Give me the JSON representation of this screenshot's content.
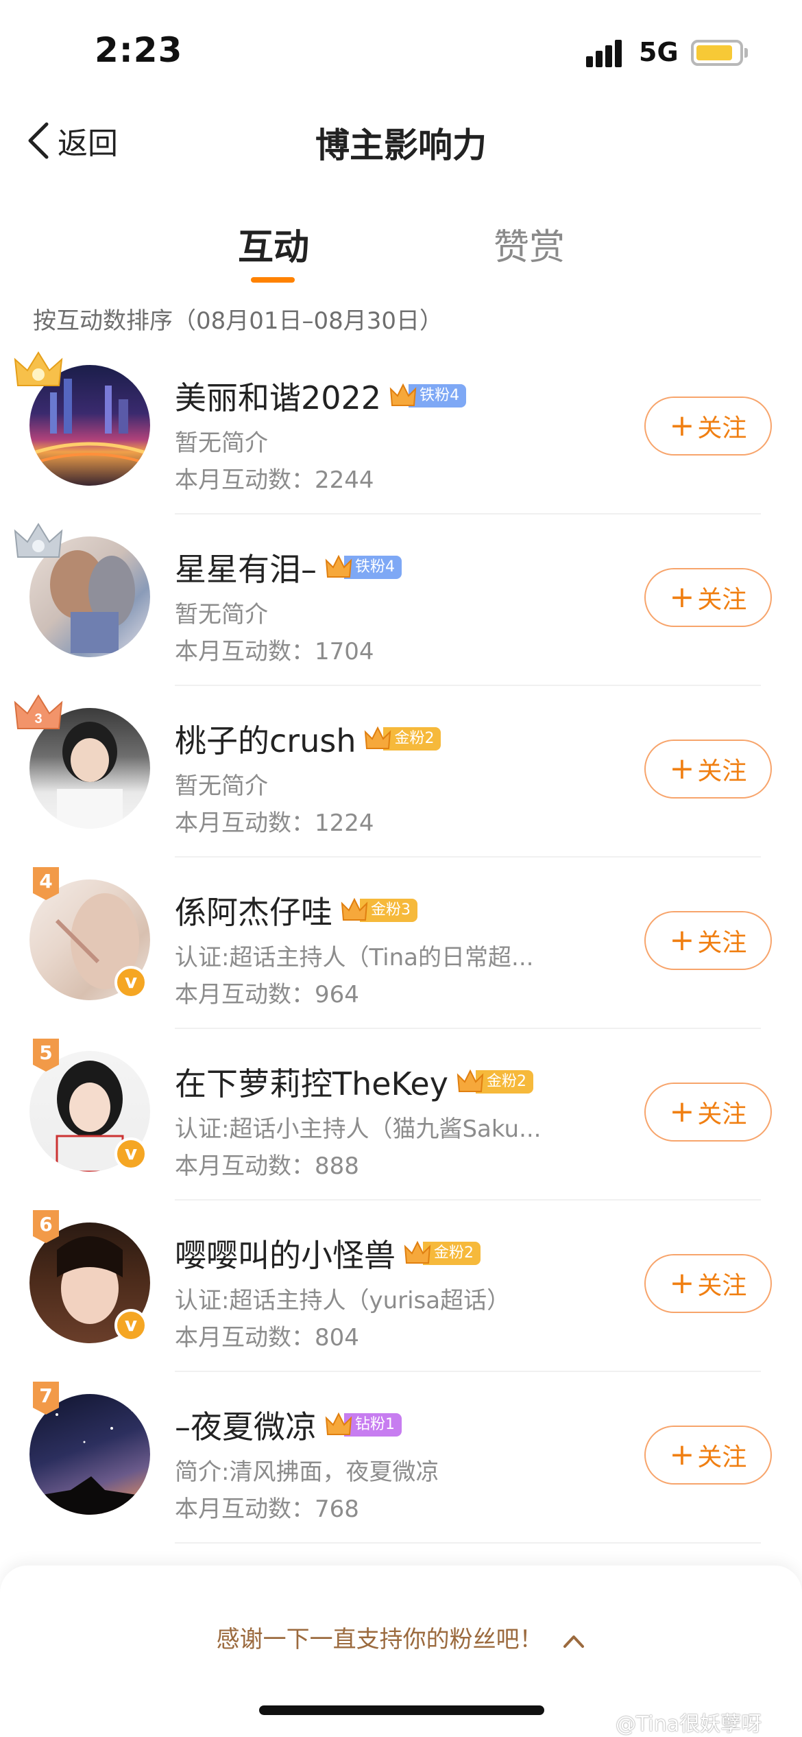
{
  "status_bar": {
    "time": "2:23",
    "network": "5G"
  },
  "header": {
    "back_label": "返回",
    "title": "博主影响力"
  },
  "tabs": [
    {
      "label": "互动",
      "active": true
    },
    {
      "label": "赞赏",
      "active": false
    }
  ],
  "sort_note": "按互动数排序（08月01日–08月30日）",
  "follow_label": "关注",
  "fans": [
    {
      "rank": "1",
      "name": "美丽和谐2022",
      "fan_level": "铁粉4",
      "badge_color": "#7ea8f5",
      "bio": "暂无简介",
      "count_label": "本月互动数：2244",
      "verified": false
    },
    {
      "rank": "2",
      "name": "星星有泪–",
      "fan_level": "铁粉4",
      "badge_color": "#7ea8f5",
      "bio": "暂无简介",
      "count_label": "本月互动数：1704",
      "verified": false
    },
    {
      "rank": "3",
      "name": "桃子的crush",
      "fan_level": "金粉2",
      "badge_color": "#f6b93b",
      "bio": "暂无简介",
      "count_label": "本月互动数：1224",
      "verified": false
    },
    {
      "rank": "4",
      "name": "係阿杰仔哇",
      "fan_level": "金粉3",
      "badge_color": "#f6b93b",
      "bio": "认证:超话主持人（Tina的日常超...",
      "count_label": "本月互动数：964",
      "verified": true
    },
    {
      "rank": "5",
      "name": "在下萝莉控TheKey",
      "fan_level": "金粉2",
      "badge_color": "#f6b93b",
      "bio": "认证:超话小主持人（猫九酱Saku...",
      "count_label": "本月互动数：888",
      "verified": true
    },
    {
      "rank": "6",
      "name": "嘤嘤叫的小怪兽",
      "fan_level": "金粉2",
      "badge_color": "#f6b93b",
      "bio": "认证:超话主持人（yurisa超话）",
      "count_label": "本月互动数：804",
      "verified": true
    },
    {
      "rank": "7",
      "name": "–夜夏微凉",
      "fan_level": "钻粉1",
      "badge_color": "#c77df0",
      "bio": "简介:清风拂面，夜夏微凉",
      "count_label": "本月互动数：768",
      "verified": false
    }
  ],
  "bottom": {
    "thanks_text": "感谢一下一直支持你的粉丝吧！"
  },
  "watermark": "@Tina很妖孽呀",
  "colors": {
    "accent": "#ff8200",
    "follow_border": "#f7a46b",
    "follow_text": "#f07f12"
  }
}
